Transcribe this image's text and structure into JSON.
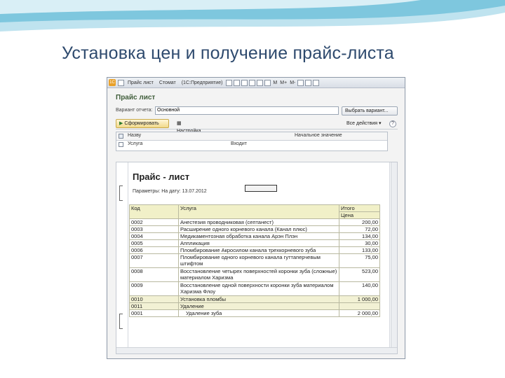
{
  "slide": {
    "title": "Установка цен и получение прайс-листа"
  },
  "window": {
    "titlebar_text_1": "Прайс лист",
    "titlebar_text_2": "Стомат",
    "titlebar_text_3": "(1С:Предприятие)",
    "titlebar_buttons": [
      "M",
      "M+",
      "M-"
    ]
  },
  "form": {
    "title": "Прайс лист",
    "price_type_label": "Вариант отчета:",
    "price_type_value": "Основной",
    "choose_variant_label": "Выбрать вариант...",
    "generate_label": "Сформировать",
    "settings_label": "Настройка...",
    "all_actions_label": "Все действия"
  },
  "grid": {
    "header": {
      "check_label": "Назву",
      "field_label": "Начальное значение"
    },
    "row": {
      "field": "Услуга",
      "condition": "Входит"
    }
  },
  "report": {
    "title": "Прайс - лист",
    "params": "Параметры:    На дату: 13.07.2012",
    "columns": {
      "code": "Код",
      "service": "Услуга",
      "price_top": "Итого",
      "price_bottom": "Цена"
    },
    "rows": [
      {
        "code": "0002",
        "service": "Анестезия проводниковая (септанест)",
        "price": "200,00"
      },
      {
        "code": "0003",
        "service": "Расширение одного корневого канала (Канал плюс)",
        "price": "72,00"
      },
      {
        "code": "0004",
        "service": "Медикаментозная обработка канала Арэн Плэн",
        "price": "134,00"
      },
      {
        "code": "0005",
        "service": "Аппликация",
        "price": "30,00"
      },
      {
        "code": "0006",
        "service": "Пломбирование Акросилом канала трехкорневого зуба",
        "price": "133,00"
      },
      {
        "code": "0007",
        "service": "Пломбирование одного корневого канала гуттаперчевым штифтом",
        "price": "75,00"
      },
      {
        "code": "0008",
        "service": "Восстановление четырех поверхностей коронки зуба (сложные) материалом Харизма",
        "price": "523,00"
      },
      {
        "code": "0009",
        "service": "Восстановление одной поверхности коронки зуба материалом Харизма Флоу",
        "price": "140,00"
      },
      {
        "code": "0010",
        "service": "Установка пломбы",
        "price": "1 000,00"
      },
      {
        "code": "0011",
        "service": "Удаление",
        "price": ""
      },
      {
        "code": "0001",
        "service": "Удаление зуба",
        "price": "2 000,00"
      }
    ]
  },
  "colors": {
    "slide_title": "#2e4a6e",
    "form_title": "#3f5d3a",
    "table_header": "#f1f0c8"
  }
}
